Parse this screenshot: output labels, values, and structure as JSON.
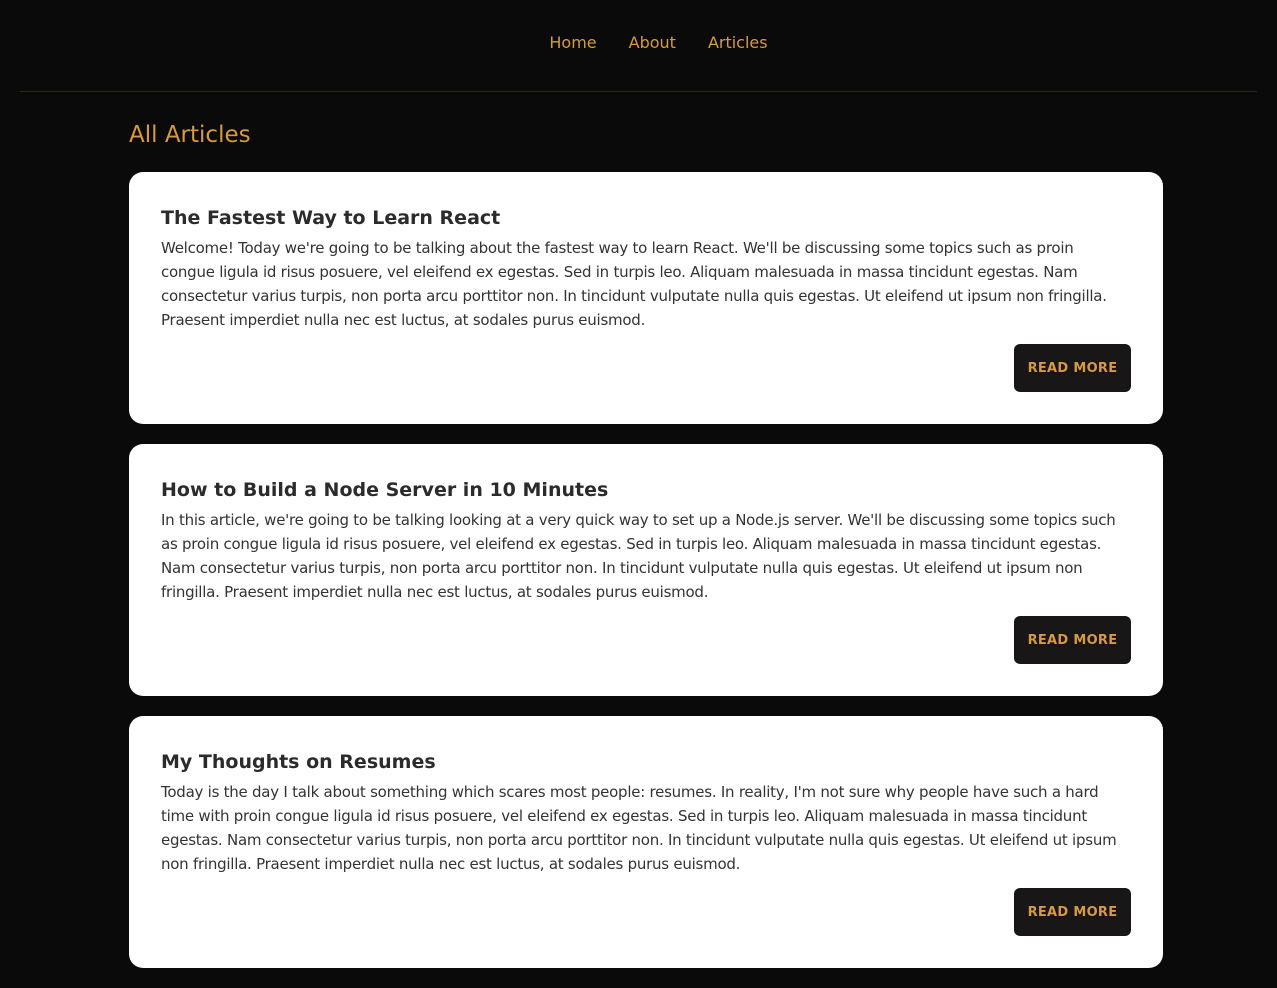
{
  "nav": {
    "items": [
      {
        "label": "Home"
      },
      {
        "label": "About"
      },
      {
        "label": "Articles"
      }
    ]
  },
  "page": {
    "title": "All Articles"
  },
  "articles": [
    {
      "title": "The Fastest Way to Learn React",
      "excerpt": "Welcome! Today we're going to be talking about the fastest way to learn React. We'll be discussing some topics such as proin congue ligula id risus posuere, vel eleifend ex egestas. Sed in turpis leo. Aliquam malesuada in massa tincidunt egestas. Nam consectetur varius turpis, non porta arcu porttitor non. In tincidunt vulputate nulla quis egestas. Ut eleifend ut ipsum non fringilla. Praesent imperdiet nulla nec est luctus, at sodales purus euismod.",
      "button_label": "READ MORE"
    },
    {
      "title": "How to Build a Node Server in 10 Minutes",
      "excerpt": "In this article, we're going to be talking looking at a very quick way to set up a Node.js server. We'll be discussing some topics such as proin congue ligula id risus posuere, vel eleifend ex egestas. Sed in turpis leo. Aliquam malesuada in massa tincidunt egestas. Nam consectetur varius turpis, non porta arcu porttitor non. In tincidunt vulputate nulla quis egestas. Ut eleifend ut ipsum non fringilla. Praesent imperdiet nulla nec est luctus, at sodales purus euismod.",
      "button_label": "READ MORE"
    },
    {
      "title": "My Thoughts on Resumes",
      "excerpt": "Today is the day I talk about something which scares most people: resumes. In reality, I'm not sure why people have such a hard time with proin congue ligula id risus posuere, vel eleifend ex egestas. Sed in turpis leo. Aliquam malesuada in massa tincidunt egestas. Nam consectetur varius turpis, non porta arcu porttitor non. In tincidunt vulputate nulla quis egestas. Ut eleifend ut ipsum non fringilla. Praesent imperdiet nulla nec est luctus, at sodales purus euismod.",
      "button_label": "READ MORE"
    }
  ],
  "colors": {
    "background": "#0a0a0a",
    "accent": "#d69a45",
    "card": "#ffffff",
    "button_bg": "#181616",
    "divider": "#2a2812"
  }
}
